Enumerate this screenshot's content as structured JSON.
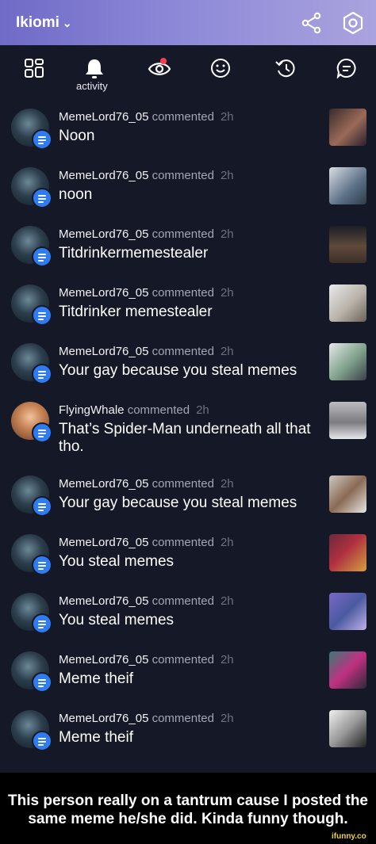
{
  "header": {
    "title": "Ikiomi",
    "title_chevron": "⌄",
    "colors": {
      "gradient_start": "#6f6bc7",
      "gradient_end": "#a9a3de"
    }
  },
  "tabs": {
    "items": [
      "dashboard-icon",
      "bell-icon",
      "eye-icon",
      "smiley-icon",
      "history-icon",
      "chat-icon"
    ],
    "active_label": "activity",
    "notification_dot_color": "#ff3b4e"
  },
  "feed": [
    {
      "user": "MemeLord76_05",
      "action": "commented",
      "time": "2h",
      "text": "Noon"
    },
    {
      "user": "MemeLord76_05",
      "action": "commented",
      "time": "2h",
      "text": "noon"
    },
    {
      "user": "MemeLord76_05",
      "action": "commented",
      "time": "2h",
      "text": "Titdrinkermemestealer"
    },
    {
      "user": "MemeLord76_05",
      "action": "commented",
      "time": "2h",
      "text": "Titdrinker memestealer"
    },
    {
      "user": "MemeLord76_05",
      "action": "commented",
      "time": "2h",
      "text": "Your gay because you steal memes"
    },
    {
      "user": "FlyingWhale",
      "action": "commented",
      "time": "2h",
      "text": "That’s Spider-Man underneath all that tho."
    },
    {
      "user": "MemeLord76_05",
      "action": "commented",
      "time": "2h",
      "text": "Your gay because you steal memes"
    },
    {
      "user": "MemeLord76_05",
      "action": "commented",
      "time": "2h",
      "text": "You steal memes"
    },
    {
      "user": "MemeLord76_05",
      "action": "commented",
      "time": "2h",
      "text": "You steal memes"
    },
    {
      "user": "MemeLord76_05",
      "action": "commented",
      "time": "2h",
      "text": "Meme theif"
    },
    {
      "user": "MemeLord76_05",
      "action": "commented",
      "time": "2h",
      "text": "Meme theif"
    }
  ],
  "caption": "This person really on a tantrum cause I posted the same meme he/she did. Kinda funny though.",
  "watermark": "ifunny.co"
}
